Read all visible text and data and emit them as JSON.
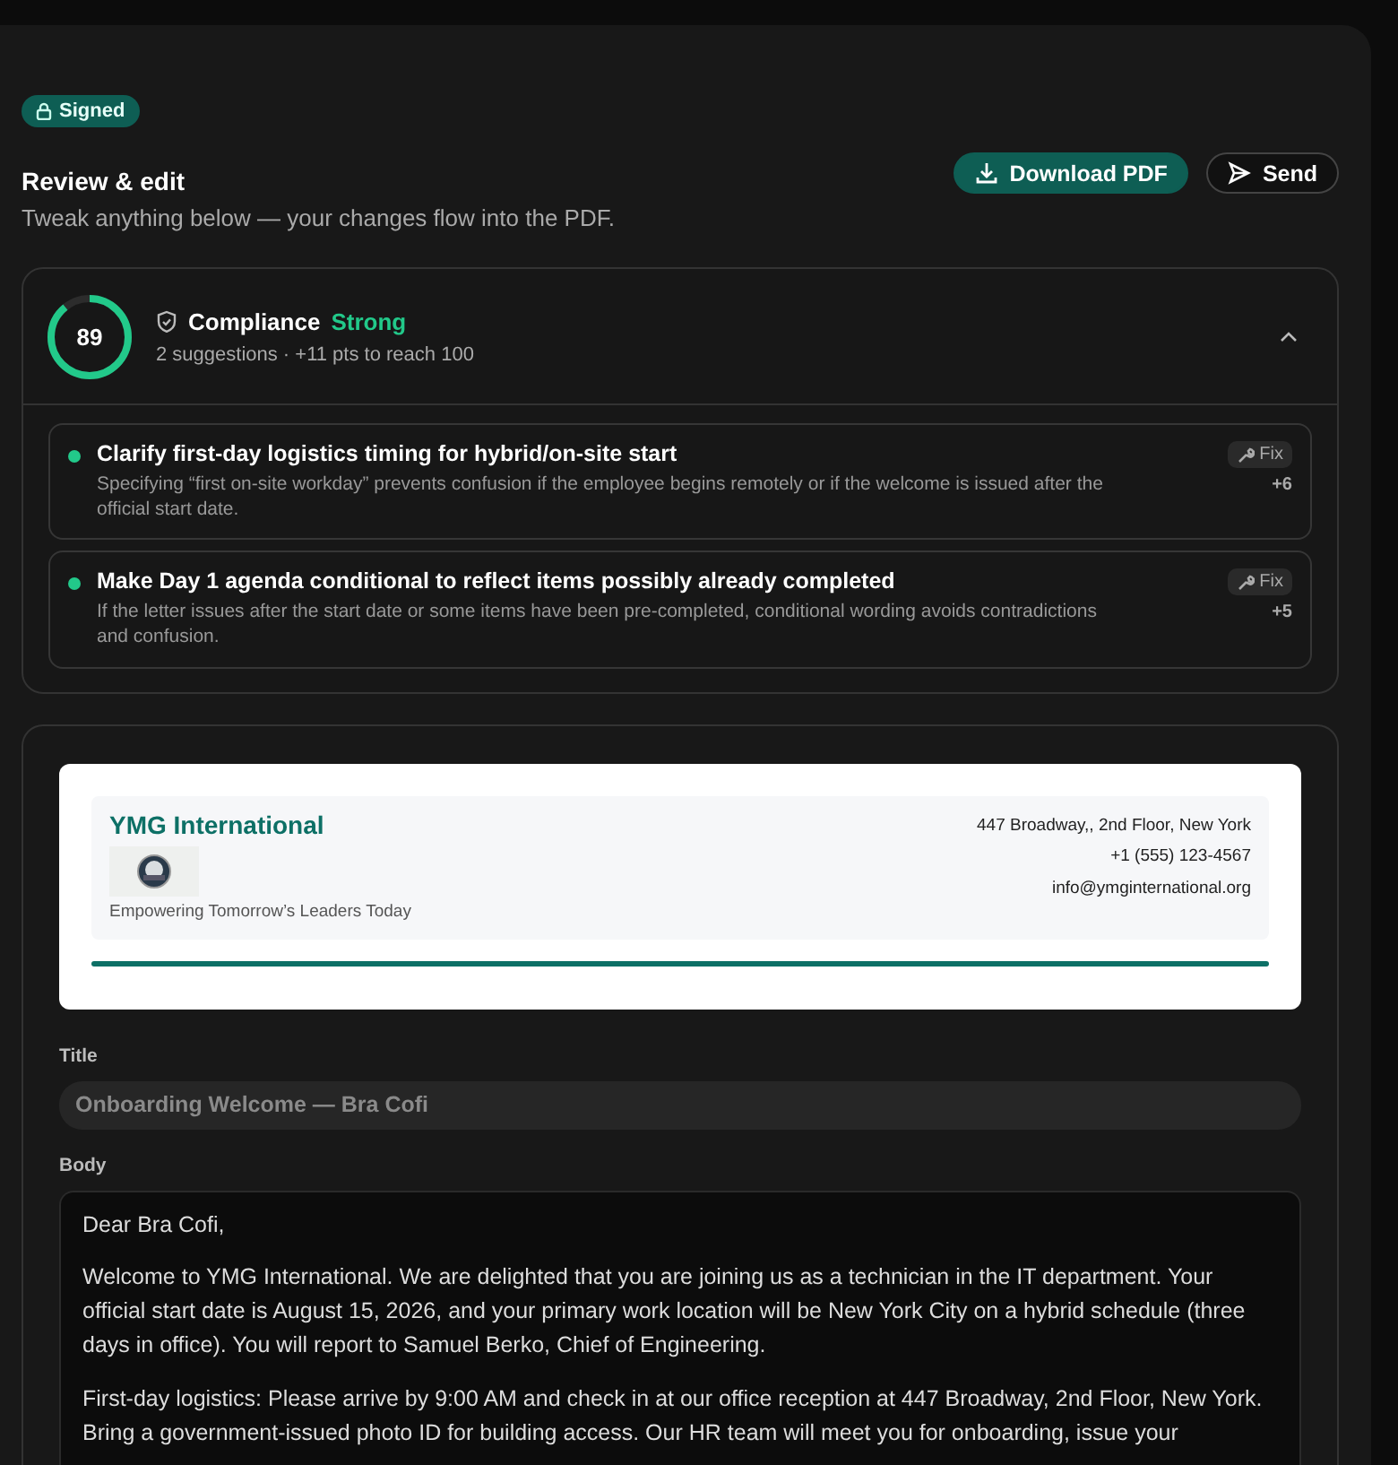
{
  "status_badge": {
    "label": "Signed"
  },
  "header": {
    "title": "Review & edit",
    "subtitle": "Tweak anything below — your changes flow into the PDF."
  },
  "actions": [
    {
      "kind": "primary",
      "label": "Download PDF"
    },
    {
      "kind": "secondary",
      "label": "Send"
    }
  ],
  "compliance": {
    "score": "89",
    "level": 0.89,
    "title": "Compliance",
    "rating": "Strong",
    "summary": "2 suggestions · +11 pts to reach 100",
    "expanded": true,
    "suggestions": [
      {
        "title": "Clarify first-day logistics timing for hybrid/on-site start",
        "detail": "Specifying “first on-site workday” prevents confusion if the employee begins remotely or if the welcome is issued after the official start date.",
        "fix_label": "Fix",
        "points": "+6",
        "color": "#22c98a"
      },
      {
        "title": "Make Day 1 agenda conditional to reflect items possibly already completed",
        "detail": "If the letter issues after the start date or some items have been pre-completed, conditional wording avoids contradictions and confusion.",
        "fix_label": "Fix",
        "points": "+5",
        "color": "#22c98a"
      }
    ]
  },
  "letterhead": {
    "company": "YMG International",
    "tagline": "Empowering Tomorrow’s Leaders Today",
    "address": "447 Broadway,, 2nd Floor, New York",
    "phone": "+1 (555) 123-4567",
    "email": "info@ymginternational.org"
  },
  "fields": {
    "title_label": "Title",
    "title_value": "Onboarding Welcome — Bra Cofi",
    "body_label": "Body",
    "body_paragraphs": [
      "Dear Bra Cofi,",
      "Welcome to YMG International. We are delighted that you are joining us as a technician in the IT department. Your official start date is August 15, 2026, and your primary work location will be New York City on a hybrid schedule (three days in office). You will report to Samuel Berko, Chief of Engineering.",
      "First-day logistics: Please arrive by 9:00 AM and check in at our office reception at 447 Broadway, 2nd Floor, New York. Bring a government-issued photo ID for building access. Our HR team will meet you for onboarding, issue your"
    ]
  }
}
